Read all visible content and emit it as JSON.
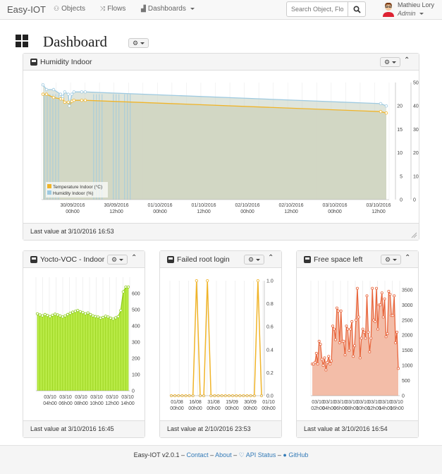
{
  "app": {
    "brand": "Easy-IOT"
  },
  "nav": {
    "objects": "Objects",
    "flows": "Flows",
    "dashboards": "Dashboards"
  },
  "search": {
    "placeholder": "Search Object, Flo"
  },
  "user": {
    "name": "Mathieu Lory",
    "role": "Admin"
  },
  "page": {
    "title": "Dashboard"
  },
  "widgets": {
    "humidity": {
      "title": "Humidity Indoor",
      "footer": "Last value at 3/10/2016 16:53",
      "legend": [
        "Temperature Indoor (°C)",
        "Humidity Indoor (%)"
      ]
    },
    "voc": {
      "title": "Yocto-VOC - Indoor",
      "footer": "Last value at 3/10/2016 16:45"
    },
    "root": {
      "title": "Failed root login",
      "footer": "Last value at 2/10/2016 23:53"
    },
    "space": {
      "title": "Free space left",
      "footer": "Last value at 3/10/2016 16:54"
    }
  },
  "footer": {
    "version": "Easy-IOT v2.0.1 –",
    "contact": "Contact",
    "sep1": "–",
    "about": "About",
    "sep2": "–",
    "api": "API Status",
    "sep3": "–",
    "github": "GitHub"
  },
  "colors": {
    "temperature": "#f0b429",
    "humidity": "#9ecae1",
    "voc": "#a4de2f",
    "root": "#f0b429",
    "space": "#e8663d"
  },
  "chart_data": [
    {
      "type": "line",
      "title": "Humidity Indoor",
      "x_ticks": [
        "30/09/2016 00h00",
        "30/09/2016 12h00",
        "01/10/2016 00h00",
        "01/10/2016 12h00",
        "02/10/2016 00h00",
        "02/10/2016 12h00",
        "03/10/2016 00h00",
        "03/10/2016 12h00"
      ],
      "y_left_ticks": [
        0,
        5,
        10,
        15,
        20
      ],
      "y_right_ticks": [
        0,
        10,
        20,
        30,
        40,
        50
      ],
      "series": [
        {
          "name": "Temperature Indoor (°C)",
          "axis": "left",
          "x": [
            0.0,
            0.5,
            1.5,
            2.5,
            2.8,
            3.1,
            3.6,
            3.75,
            4.1,
            4.4,
            5.5,
            6.0,
            48.0,
            48.8
          ],
          "values": [
            22.5,
            22.5,
            21.8,
            21.5,
            21.5,
            20.8,
            20.8,
            20.0,
            21.0,
            21.2,
            21.2,
            21.2,
            18.8,
            18.5
          ]
        },
        {
          "name": "Humidity Indoor (%)",
          "axis": "right",
          "x": [
            0.0,
            0.5,
            1.5,
            2.5,
            2.8,
            3.1,
            3.6,
            3.75,
            4.1,
            4.4,
            5.5,
            6.0,
            48.0,
            48.8
          ],
          "values": [
            49,
            47,
            47,
            45,
            44,
            46,
            45,
            40,
            45,
            46,
            46,
            46,
            41,
            40
          ]
        }
      ]
    },
    {
      "type": "area",
      "title": "Yocto-VOC - Indoor",
      "x_ticks": [
        "03/10/2016 04h00",
        "03/10/2016 06h00",
        "03/10/2016 08h00",
        "03/10/2016 10h00",
        "03/10/2016 12h00",
        "03/10/2016 14h00"
      ],
      "y_ticks": [
        0,
        100,
        200,
        300,
        400,
        500,
        600
      ],
      "ylim": [
        0,
        700
      ],
      "series": [
        {
          "name": "",
          "values": [
            475,
            468,
            462,
            470,
            465,
            458,
            466,
            472,
            468,
            462,
            455,
            462,
            470,
            478,
            485,
            490,
            495,
            488,
            482,
            475,
            480,
            470,
            462,
            458,
            455,
            448,
            452,
            460,
            455,
            448,
            442,
            450,
            458,
            495,
            610,
            640,
            640
          ]
        }
      ]
    },
    {
      "type": "line",
      "title": "Failed root login",
      "x_ticks": [
        "01/08/2016 00h00",
        "16/08/2016 00h00",
        "31/08/2016 00h00",
        "15/09/2016 00h00",
        "30/09/2016 00h00",
        "01/10/2016 00h00"
      ],
      "y_ticks": [
        0,
        0.2,
        0.4,
        0.6,
        0.8,
        1.0
      ],
      "ylim": [
        0,
        1
      ],
      "series": [
        {
          "name": "",
          "values": [
            0,
            0,
            0,
            0,
            0,
            0,
            0,
            1,
            0,
            0,
            1,
            0,
            0,
            0,
            0,
            0,
            0,
            0,
            0,
            0,
            0,
            0,
            0,
            0,
            1,
            0
          ]
        }
      ]
    },
    {
      "type": "area",
      "title": "Free space left",
      "x_ticks": [
        "03/10/2016 02h00",
        "03/10/2016 04h00",
        "03/10/2016 06h00",
        "03/10/2016 08h00",
        "03/10/2016 10h00",
        "03/10/2016 12h00",
        "03/10/2016 14h00",
        "03/10/2016 16h00"
      ],
      "y_ticks": [
        0,
        500,
        1000,
        1500,
        2000,
        2500,
        3000,
        3500
      ],
      "ylim": [
        0,
        3800
      ],
      "series": [
        {
          "name": "",
          "values": [
            1050,
            1050,
            1100,
            1400,
            1050,
            1800,
            1700,
            1200,
            1000,
            1250,
            850,
            1100,
            1300,
            1050,
            1150,
            2300,
            2200,
            1850,
            2900,
            2800,
            1750,
            2800,
            1800,
            1800,
            1350,
            2300,
            2200,
            1500,
            2200,
            2450,
            1300,
            1650,
            2500,
            3550,
            2600,
            1250,
            1900,
            2200,
            2100,
            1900,
            3300,
            2100,
            1450,
            1900,
            3550,
            2500,
            2450,
            3550,
            2200,
            3000,
            3000,
            3400,
            2600,
            3200,
            1950,
            2050,
            3450,
            3350,
            2650,
            2650,
            3300,
            1750,
            2100,
            900
          ]
        }
      ]
    }
  ]
}
